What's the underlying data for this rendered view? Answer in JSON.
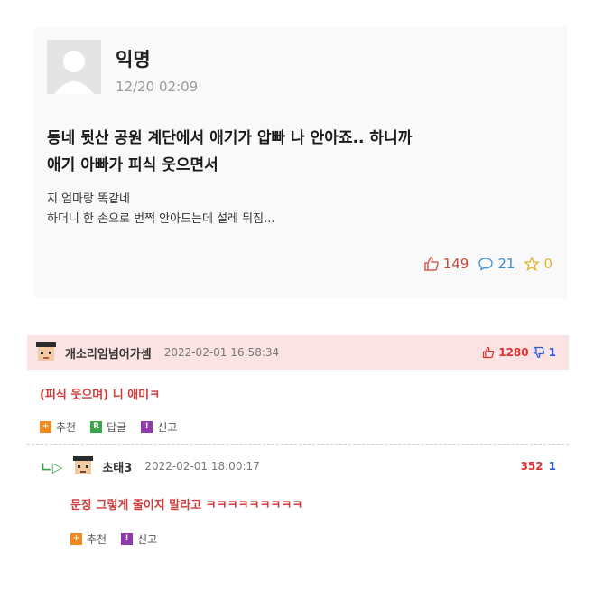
{
  "post": {
    "author": "익명",
    "time": "12/20 02:09",
    "title_line1": "동네 뒷산 공원 계단에서 애기가 압빠 나 안아죠.. 하니까",
    "title_line2": "애기 아빠가 피식 웃으면서",
    "body_line1": "지 엄마랑 똑같네",
    "body_line2": "하더니 한 손으로 번쩍 안아드는데 설레 뒤짐...",
    "likes": "149",
    "comments": "21",
    "scraps": "0"
  },
  "comment1": {
    "name": "개소리임넘어가셈",
    "date": "2022-02-01 16:58:34",
    "upvotes": "1280",
    "downvotes": "1",
    "text": "(피식 웃으며) 니 애미ㅋ",
    "actions": {
      "recommend": "추천",
      "reply": "답글",
      "report": "신고"
    }
  },
  "reply1": {
    "arrow": "ㄴ▷",
    "name": "초태3",
    "date": "2022-02-01 18:00:17",
    "upvotes": "352",
    "downvotes": "1",
    "text": "문장 그렇게 줄이지 말라고 ㅋㅋㅋㅋㅋㅋㅋㅋㅋ",
    "actions": {
      "recommend": "추천",
      "report": "신고"
    }
  },
  "icons": {
    "square_rec_glyph": "+",
    "square_rep_glyph": "R",
    "square_rpt_glyph": "!"
  },
  "colors": {
    "comment_text": "#d23b3b",
    "comment_head_bg": "#fbe3e3",
    "like": "#c84a3a",
    "comment_count": "#3a8fd0",
    "scrap": "#e1b32a"
  }
}
